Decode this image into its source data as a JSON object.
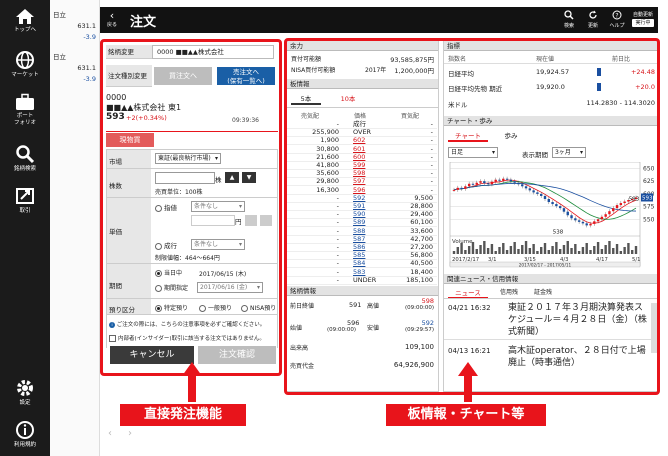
{
  "sidebar": {
    "items": [
      {
        "label": "トップへ",
        "icon": "home-icon"
      },
      {
        "label": "マーケット",
        "icon": "globe-icon"
      },
      {
        "label": "ポート\nフォリオ",
        "icon": "briefcase-icon"
      },
      {
        "label": "銘柄検索",
        "icon": "search-icon"
      },
      {
        "label": "取引",
        "icon": "trade-icon"
      },
      {
        "label": "設定",
        "icon": "gear-icon"
      },
      {
        "label": "利用規約",
        "icon": "info-icon"
      }
    ]
  },
  "mini": {
    "items": [
      {
        "name": "日立",
        "price": "631.1",
        "change": "-3.9"
      },
      {
        "name": "日立",
        "price": "631.1",
        "change": "-3.9"
      }
    ]
  },
  "header": {
    "back": "戻る",
    "title": "注文",
    "search": "検索",
    "update": "更新",
    "help": "ヘルプ",
    "auto_update": "自動更新",
    "auto_state": "実行中"
  },
  "order": {
    "stock_change_label": "銘柄変更",
    "stock_value": "0000 ■■▲▲株式会社",
    "type_change_label": "注文種別変更",
    "buy_btn": "買注文へ",
    "sell_btn": "売注文へ\n(保有一覧へ)",
    "code": "0000",
    "name": "■■▲▲株式会社 東1",
    "price": "593",
    "change": "+2(+0.34%)",
    "time": "09:39:36",
    "tab": "現物買",
    "market_label": "市場",
    "market_value": "東証(最良執行市場)",
    "qty_label": "株数",
    "qty_unit": "株",
    "unit_label": "売買単位：100株",
    "price_label": "単価",
    "limit_label": "指値",
    "cond1": "条件なし",
    "yen": "円",
    "market_order": "成行",
    "cond2": "条件なし",
    "range": "制限値幅：464～664円",
    "period_label": "期間",
    "today": "当日中",
    "today_date": "2017/06/15 (木)",
    "period_spec": "期間指定",
    "period_date": "2017/06/16 (金)",
    "deposit_label": "預り区分",
    "specific": "特定預り",
    "general": "一般預り",
    "nisa": "NISA預り",
    "notice": "ご注文の際には、こちらの注意事項を必ずご確認ください。",
    "insider": "内部者(インサイダー)取引に該当する注文ではありません。",
    "cancel": "キャンセル",
    "confirm": "注文確認"
  },
  "mid": {
    "yoryoku": "余力",
    "buy_power_label": "買付可能額",
    "buy_power": "93,585,875円",
    "nisa_label": "NISA買付可能額",
    "nisa_year": "2017年",
    "nisa_value": "1,200,000円",
    "board": "板情報",
    "tab5": "5本",
    "tab10": "10本",
    "col_sell": "売気配",
    "col_price": "価格",
    "col_buy": "買気配",
    "rows": [
      [
        "-",
        "成行",
        "-"
      ],
      [
        "255,900",
        "OVER",
        "-"
      ],
      [
        "1,900",
        "602",
        "-"
      ],
      [
        "30,800",
        "601",
        "-"
      ],
      [
        "21,600",
        "600",
        "-"
      ],
      [
        "41,800",
        "599",
        "-"
      ],
      [
        "35,600",
        "598",
        "-"
      ],
      [
        "29,800",
        "597",
        "-"
      ],
      [
        "16,300",
        "596",
        "-"
      ],
      [
        "-",
        "592",
        "9,500"
      ],
      [
        "-",
        "591",
        "28,800"
      ],
      [
        "-",
        "590",
        "29,400"
      ],
      [
        "-",
        "589",
        "60,100"
      ],
      [
        "-",
        "588",
        "33,600"
      ],
      [
        "-",
        "587",
        "42,700"
      ],
      [
        "-",
        "586",
        "27,200"
      ],
      [
        "-",
        "585",
        "56,800"
      ],
      [
        "-",
        "584",
        "40,500"
      ],
      [
        "-",
        "583",
        "18,400"
      ],
      [
        "-",
        "UNDER",
        "185,100"
      ]
    ],
    "stock_info": "銘柄情報",
    "open_label": "前日終値",
    "open": "591",
    "high_label": "高値",
    "high": "598",
    "high_time": "(09:00:00)",
    "start_label": "始値",
    "start": "596",
    "start_time": "(09:00:00)",
    "low_label": "安値",
    "low": "592",
    "low_time": "(09:29:57)",
    "volume_label": "出来高",
    "volume": "109,100",
    "value_label": "売買代金",
    "value": "64,926,900"
  },
  "right": {
    "index": "指標",
    "idx_col1": "指数名",
    "idx_col2": "現在値",
    "idx_col3": "前日比",
    "indices": [
      {
        "name": "日経平均",
        "value": "19,924.57",
        "change": "+24.48"
      },
      {
        "name": "日経平均先物 期近",
        "value": "19,920.0",
        "change": "+20.0"
      },
      {
        "name": "米ドル",
        "value": "114.2830 - 114.3020",
        "change": ""
      }
    ],
    "chart_title": "チャート・歩み",
    "tab_chart": "チャート",
    "tab_ayumi": "歩み",
    "period_label": "表示期間",
    "span": "日足",
    "period": "3ヶ月",
    "volume_label": "Volume",
    "news_title": "関連ニュース・信用情報",
    "news_tab": "ニュース",
    "credit_tab": "信用残",
    "margin_tab": "証金残",
    "news": [
      {
        "time": "04/21 16:32",
        "text": "東証２０１７年３月期決算発表スケジュール＝４月２８日（金）（株式新聞）"
      },
      {
        "time": "04/13 16:21",
        "text": "高木証operator、２８日付で上場廃止（時事通信）"
      }
    ]
  },
  "callouts": {
    "left": "直接発注機能",
    "right": "板情報・チャート等"
  },
  "chart_data": {
    "type": "line",
    "x_labels": [
      "2017/2/17",
      "3/1",
      "3/15",
      "4/3",
      "4/17",
      "5/1"
    ],
    "ylim": [
      525,
      655
    ],
    "y_ticks": [
      650,
      625,
      600,
      575,
      550
    ],
    "annotations": [
      {
        "label": "538",
        "value": 538
      },
      {
        "label": "593",
        "value": 593
      }
    ],
    "range_label": "2017/02/17 - 2017/05/11",
    "series": [
      {
        "values": [
          608,
          612,
          610,
          615,
          620,
          618,
          622,
          625,
          621,
          619,
          624,
          628,
          626,
          630,
          628,
          625,
          622,
          619,
          615,
          611,
          607,
          603,
          600,
          596,
          590,
          584,
          580,
          576,
          572,
          565,
          558,
          552,
          548,
          545,
          542,
          538,
          541,
          546,
          550,
          555,
          560,
          566,
          572,
          578,
          582,
          585,
          588,
          590,
          593
        ]
      }
    ]
  }
}
